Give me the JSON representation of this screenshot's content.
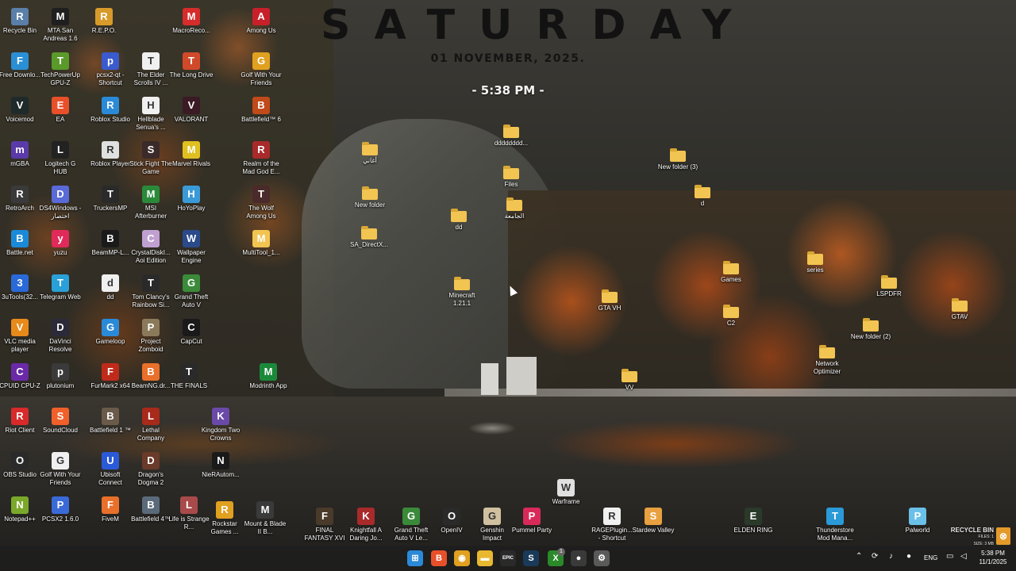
{
  "clock": {
    "day": "SATURDAY",
    "date": "01 NOVEMBER, 2025.",
    "time": "- 5:38 PM -"
  },
  "desktop_icons": [
    {
      "label": "Recycle Bin",
      "icon": "recycle-bin-icon",
      "color": "#5a7fa8"
    },
    {
      "label": "MTA San Andreas 1.6",
      "icon": "mta-icon",
      "color": "#1f1f1f"
    },
    {
      "label": "R.E.P.O.",
      "icon": "repo-icon",
      "color": "#d89a2a"
    },
    {
      "label": "MacroReco...",
      "icon": "macro-recorder-icon",
      "color": "#d62c2c"
    },
    {
      "label": "Among Us",
      "icon": "among-us-icon",
      "color": "#c8202a"
    },
    {
      "label": "Free Downlo...",
      "icon": "free-download-manager-icon",
      "color": "#2a8fd4"
    },
    {
      "label": "TechPowerUp GPU-Z",
      "icon": "gpu-z-icon",
      "color": "#5a9a2a"
    },
    {
      "label": "pcsx2-qt - Shortcut",
      "icon": "pcsx2-icon",
      "color": "#3a5acd"
    },
    {
      "label": "The Elder Scrolls IV ...",
      "icon": "document-icon",
      "color": "#f0f0f0"
    },
    {
      "label": "The Long Drive",
      "icon": "the-long-drive-icon",
      "color": "#d04a2a"
    },
    {
      "label": "Golf With Your Friends",
      "icon": "golf-icon",
      "color": "#e0a020"
    },
    {
      "label": "Voicemod",
      "icon": "voicemod-icon",
      "color": "#1f2a2a"
    },
    {
      "label": "EA",
      "icon": "ea-icon",
      "color": "#e8502a"
    },
    {
      "label": "Roblox Studio",
      "icon": "roblox-studio-icon",
      "color": "#2a8ad8"
    },
    {
      "label": "Hellblade Senua's ...",
      "icon": "document-icon",
      "color": "#f0f0f0"
    },
    {
      "label": "VALORANT",
      "icon": "valorant-icon",
      "color": "#3a1a24"
    },
    {
      "label": "Battlefield™ 6",
      "icon": "battlefield-6-icon",
      "color": "#c04a1a"
    },
    {
      "label": "mGBA",
      "icon": "mgba-icon",
      "color": "#5a3aa8"
    },
    {
      "label": "Logitech G HUB",
      "icon": "logitech-icon",
      "color": "#222222"
    },
    {
      "label": "Roblox Player",
      "icon": "roblox-icon",
      "color": "#e0e0e0"
    },
    {
      "label": "Stick Fight The Game",
      "icon": "stick-fight-icon",
      "color": "#3a2a2a"
    },
    {
      "label": "Marvel Rivals",
      "icon": "marvel-rivals-icon",
      "color": "#e0c020"
    },
    {
      "label": "Realm of the Mad God E...",
      "icon": "realm-icon",
      "color": "#a82a2a"
    },
    {
      "label": "RetroArch",
      "icon": "retroarch-icon",
      "color": "#3a3a3a"
    },
    {
      "label": "DS4Windows - اختصار",
      "icon": "ds4windows-icon",
      "color": "#5a6ad8"
    },
    {
      "label": "TruckersMP",
      "icon": "truckersmp-icon",
      "color": "#2a2a2a"
    },
    {
      "label": "MSI Afterburner",
      "icon": "msi-icon",
      "color": "#2a8a3a"
    },
    {
      "label": "HoYoPlay",
      "icon": "hoyoplay-icon",
      "color": "#3a9ad8"
    },
    {
      "label": "The Wolf Among Us",
      "icon": "wolf-among-us-icon",
      "color": "#4a2a2a"
    },
    {
      "label": "Battle.net",
      "icon": "battlenet-icon",
      "color": "#1a8ad8"
    },
    {
      "label": "yuzu",
      "icon": "yuzu-icon",
      "color": "#e02a5a"
    },
    {
      "label": "BeamMP-L...",
      "icon": "beammp-icon",
      "color": "#1a1a1a"
    },
    {
      "label": "CrystalDiskI... Aoi Edition",
      "icon": "crystaldisk-icon",
      "color": "#c0a0d0"
    },
    {
      "label": "Wallpaper Engine",
      "icon": "wallpaper-engine-icon",
      "color": "#2a4a8a"
    },
    {
      "label": "MultiTool_1...",
      "icon": "folder-icon",
      "color": "#f2c451"
    },
    {
      "label": "3uTools(32...",
      "icon": "3utools-icon",
      "color": "#2a6ad8"
    },
    {
      "label": "Telegram Web",
      "icon": "telegram-icon",
      "color": "#2aa0d8"
    },
    {
      "label": "dd",
      "icon": "document-icon",
      "color": "#f0f0f0"
    },
    {
      "label": "Tom Clancy's Rainbow Si...",
      "icon": "rainbow-six-icon",
      "color": "#2a2a2a"
    },
    {
      "label": "Grand Theft Auto V",
      "icon": "gta-v-icon",
      "color": "#3a8a3a"
    },
    {
      "label": "VLC media player",
      "icon": "vlc-icon",
      "color": "#e88a1a"
    },
    {
      "label": "DaVinci Resolve",
      "icon": "davinci-icon",
      "color": "#2a2a3a"
    },
    {
      "label": "Gameloop",
      "icon": "gameloop-icon",
      "color": "#2a8ad8"
    },
    {
      "label": "Project Zomboid",
      "icon": "zomboid-icon",
      "color": "#8a7a5a"
    },
    {
      "label": "CapCut",
      "icon": "capcut-icon",
      "color": "#1a1a1a"
    },
    {
      "label": "CPUID CPU-Z",
      "icon": "cpu-z-icon",
      "color": "#6a2aa8"
    },
    {
      "label": "plutonium",
      "icon": "plutonium-icon",
      "color": "#3a3a3a"
    },
    {
      "label": "FurMark2 x64",
      "icon": "furmark-icon",
      "color": "#c02a1a"
    },
    {
      "label": "BeamNG.dr...",
      "icon": "beamng-icon",
      "color": "#e8702a"
    },
    {
      "label": "THE FINALS",
      "icon": "the-finals-icon",
      "color": "#2a2a2a"
    },
    {
      "label": "Modrinth App",
      "icon": "modrinth-icon",
      "color": "#1a8a3a"
    },
    {
      "label": "Riot Client",
      "icon": "riot-icon",
      "color": "#d82a2a"
    },
    {
      "label": "SoundCloud",
      "icon": "soundcloud-icon",
      "color": "#f0602a"
    },
    {
      "label": "Battlefield 1 ™",
      "icon": "battlefield-1-icon",
      "color": "#6a5a4a"
    },
    {
      "label": "Lethal Company",
      "icon": "lethal-company-icon",
      "color": "#a82a1a"
    },
    {
      "label": "Kingdom Two Crowns",
      "icon": "kingdom-icon",
      "color": "#6a4aa8"
    },
    {
      "label": "OBS Studio",
      "icon": "obs-icon",
      "color": "#2a2a2a"
    },
    {
      "label": "Golf With Your Friends",
      "icon": "document-icon",
      "color": "#f0f0f0"
    },
    {
      "label": "Ubisoft Connect",
      "icon": "ubisoft-icon",
      "color": "#2a5ad8"
    },
    {
      "label": "Dragon's Dogma 2",
      "icon": "dragons-dogma-icon",
      "color": "#6a3a2a"
    },
    {
      "label": "NieRAutom...",
      "icon": "nier-icon",
      "color": "#1a1a1a"
    },
    {
      "label": "Notepad++",
      "icon": "notepad-plus-icon",
      "color": "#7aa82a"
    },
    {
      "label": "PCSX2 1.6.0",
      "icon": "pcsx2-old-icon",
      "color": "#3a6ad8"
    },
    {
      "label": "FiveM",
      "icon": "fivem-icon",
      "color": "#e8702a"
    },
    {
      "label": "Battlefield 4™",
      "icon": "battlefield-4-icon",
      "color": "#5a6a7a"
    },
    {
      "label": "Life is Strange R...",
      "icon": "life-is-strange-icon",
      "color": "#a84a4a"
    },
    {
      "label": "Rockstar Games ...",
      "icon": "rockstar-icon",
      "color": "#e0a020"
    },
    {
      "label": "Mount & Blade II B...",
      "icon": "mount-blade-icon",
      "color": "#3a3a3a"
    },
    {
      "label": "FINAL FANTASY XVI",
      "icon": "final-fantasy-icon",
      "color": "#4a3a2a"
    },
    {
      "label": "Knightfall A Daring Jo...",
      "icon": "knightfall-icon",
      "color": "#a82a2a"
    },
    {
      "label": "Grand Theft Auto V Le...",
      "icon": "gta-v-legacy-icon",
      "color": "#3a8a3a"
    },
    {
      "label": "OpenIV",
      "icon": "openiv-icon",
      "color": "#2a2a2a"
    },
    {
      "label": "Genshin Impact",
      "icon": "genshin-icon",
      "color": "#d0c0a0"
    },
    {
      "label": "Pummel Party",
      "icon": "pummel-party-icon",
      "color": "#d82a5a"
    },
    {
      "label": "Warframe",
      "icon": "warframe-icon",
      "color": "#e0e0e0"
    },
    {
      "label": "RAGEPlugin... - Shortcut",
      "icon": "document-icon",
      "color": "#f0f0f0"
    },
    {
      "label": "Stardew Valley",
      "icon": "stardew-icon",
      "color": "#e8a040"
    },
    {
      "label": "ELDEN RING",
      "icon": "elden-ring-icon",
      "color": "#2a3a2a"
    },
    {
      "label": "Thunderstore Mod Mana...",
      "icon": "thunderstore-icon",
      "color": "#2a9ad8"
    },
    {
      "label": "Palworld",
      "icon": "palworld-icon",
      "color": "#6ac0e8"
    }
  ],
  "desktop_folders": [
    {
      "label": "أغاني"
    },
    {
      "label": "dddddddd..."
    },
    {
      "label": "Files"
    },
    {
      "label": "New folder"
    },
    {
      "label": "dd"
    },
    {
      "label": "الجامعة"
    },
    {
      "label": "SA_DirectX..."
    },
    {
      "label": "New folder (3)"
    },
    {
      "label": "d"
    },
    {
      "label": "Minecraft 1.21.1"
    },
    {
      "label": "GTA VH"
    },
    {
      "label": "Games"
    },
    {
      "label": "series"
    },
    {
      "label": "LSPDFR"
    },
    {
      "label": "C2"
    },
    {
      "label": "New folder (2)"
    },
    {
      "label": "GTAV"
    },
    {
      "label": "Network Optimizer"
    },
    {
      "label": "VV"
    }
  ],
  "recycle_widget": {
    "title": "RECYCLE BIN",
    "files": "FILES: 1",
    "size": "SIZE: 3 MB"
  },
  "taskbar": {
    "apps": [
      {
        "name": "start-button",
        "glyph": "⊞",
        "color": "#2a8ad8"
      },
      {
        "name": "brave-browser",
        "glyph": "B",
        "color": "#e8502a"
      },
      {
        "name": "chrome-browser",
        "glyph": "◉",
        "color": "#e0a020"
      },
      {
        "name": "file-explorer",
        "glyph": "▬",
        "color": "#e8b830"
      },
      {
        "name": "epic-games",
        "glyph": "EPIC",
        "color": "#2a2a2a"
      },
      {
        "name": "steam",
        "glyph": "S",
        "color": "#1a3a5a"
      },
      {
        "name": "xbox",
        "glyph": "X",
        "color": "#2a8a2a"
      },
      {
        "name": "obs-taskbar",
        "glyph": "●",
        "color": "#3a3a3a"
      },
      {
        "name": "settings",
        "glyph": "⚙",
        "color": "#5a5a5a"
      }
    ],
    "xbox_badge": "1",
    "language": "ENG",
    "time": "5:38 PM",
    "date": "11/1/2025"
  }
}
